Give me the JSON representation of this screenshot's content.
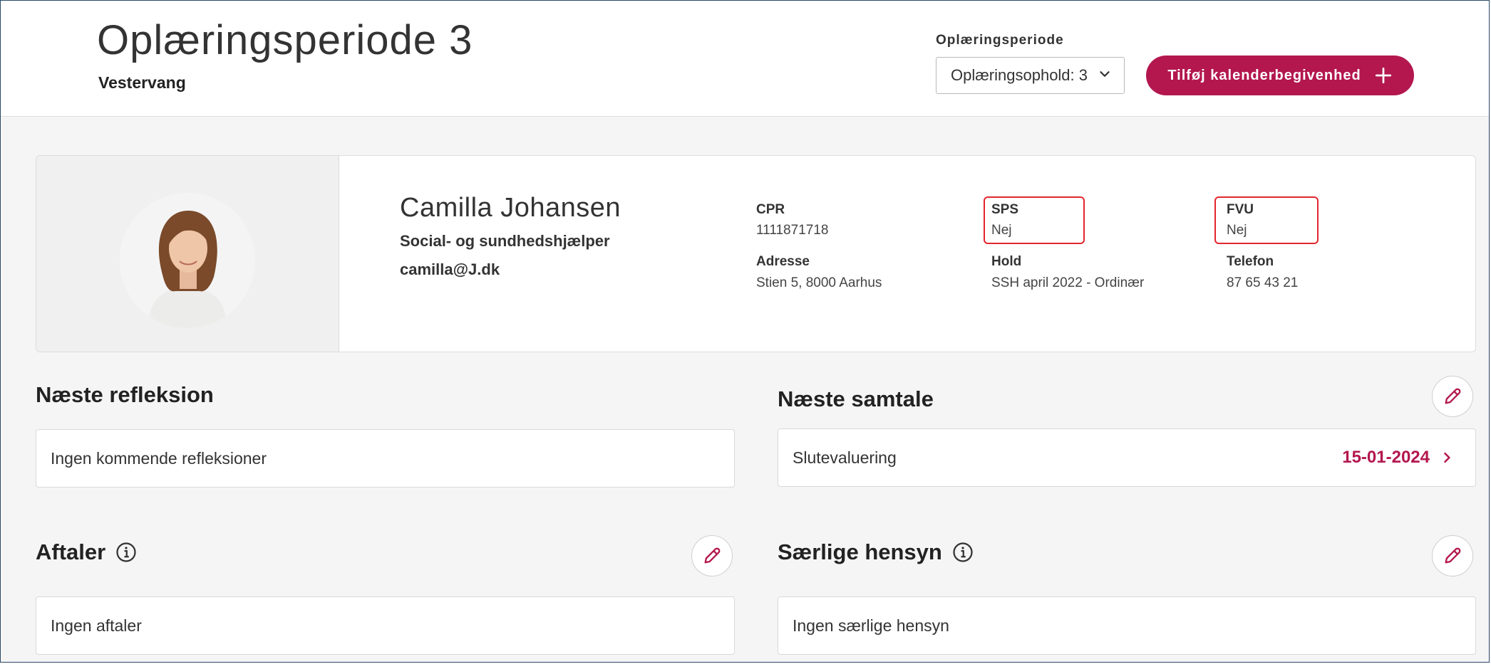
{
  "header": {
    "title": "Oplæringsperiode 3",
    "subtitle": "Vestervang",
    "period_label": "Oplæringsperiode",
    "period_select_value": "Oplæringsophold: 3",
    "add_button_label": "Tilføj kalenderbegivenhed"
  },
  "profile": {
    "name": "Camilla Johansen",
    "role": "Social- og sundhedshjælper",
    "email": "camilla@J.dk",
    "fields": {
      "cpr_label": "CPR",
      "cpr_value": "1111871718",
      "sps_label": "SPS",
      "sps_value": "Nej",
      "fvu_label": "FVU",
      "fvu_value": "Nej",
      "address_label": "Adresse",
      "address_value": "Stien 5, 8000 Aarhus",
      "hold_label": "Hold",
      "hold_value": "SSH april 2022 - Ordinær",
      "phone_label": "Telefon",
      "phone_value": "87 65 43 21"
    }
  },
  "sections": {
    "reflection": {
      "title": "Næste refleksion",
      "empty_text": "Ingen kommende refleksioner"
    },
    "conversation": {
      "title": "Næste samtale",
      "item_label": "Slutevaluering",
      "item_date": "15-01-2024"
    },
    "agreements": {
      "title": "Aftaler",
      "empty_text": "Ingen aftaler"
    },
    "special": {
      "title": "Særlige hensyn",
      "empty_text": "Ingen særlige hensyn"
    }
  },
  "colors": {
    "accent": "#b3174e",
    "highlight_border": "#e3262e",
    "background": "#f6f5f5"
  },
  "icons": {
    "select_chevron": "chevron-down-icon",
    "add": "plus-icon",
    "edit": "pencil-icon",
    "info": "info-icon",
    "date_chevron": "chevron-right-icon"
  }
}
